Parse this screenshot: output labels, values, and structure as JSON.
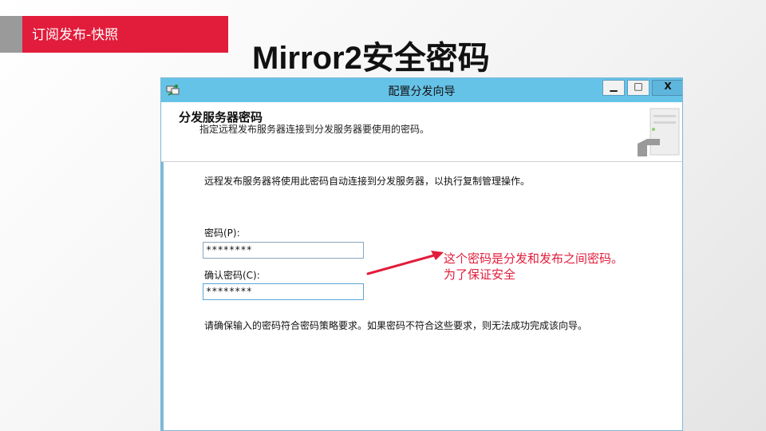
{
  "slide": {
    "tag_label": "订阅发布-快照",
    "title": "Mirror2安全密码",
    "annotation_line1": "这个密码是分发和发布之间密码。",
    "annotation_line2": "为了保证安全"
  },
  "window": {
    "title": "配置分发向导",
    "controls": {
      "minimize": "▁",
      "maximize": "□",
      "close": "X"
    },
    "header": {
      "title": "分发服务器密码",
      "subtitle": "指定远程发布服务器连接到分发服务器要使用的密码。"
    },
    "body": {
      "intro": "远程发布服务器将使用此密码自动连接到分发服务器，以执行复制管理操作。",
      "password_label": "密码(P):",
      "password_value": "********",
      "confirm_label": "确认密码(C):",
      "confirm_value": "********",
      "note": "请确保输入的密码符合密码策略要求。如果密码不符合这些要求，则无法成功完成该向导。"
    }
  },
  "colors": {
    "accent_red": "#e21c3b",
    "titlebar_blue": "#66c3e8"
  }
}
